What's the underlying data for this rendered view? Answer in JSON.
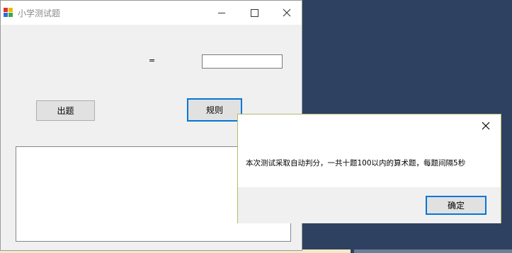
{
  "window": {
    "title": "小学测试题",
    "equals_sign": "=",
    "answer_value": "",
    "generate_button": "出题",
    "rules_button": "规则",
    "question_area_text": ""
  },
  "dialog": {
    "message": "本次测试采取自动判分，一共十题100以内的算术题，每题间隔5秒",
    "ok_button": "确定"
  },
  "colors": {
    "desktop": "#2e4160",
    "focus_border": "#0078d7",
    "window_bg": "#f0f0f0"
  },
  "icons": [
    "app-icon",
    "minimize-icon",
    "maximize-icon",
    "close-icon"
  ]
}
